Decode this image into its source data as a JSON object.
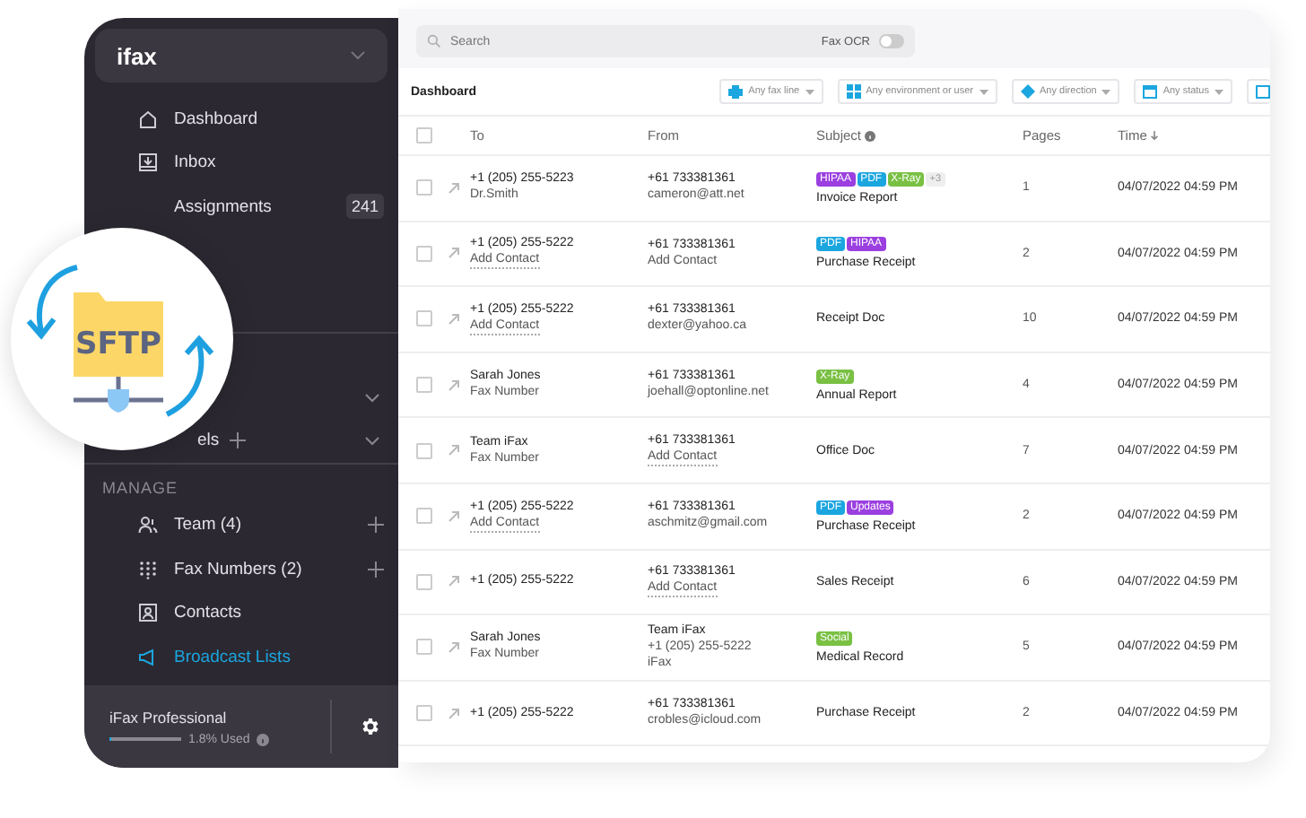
{
  "sidebar": {
    "logo": "ifax",
    "nav": [
      {
        "label": "Dashboard",
        "selected": false
      },
      {
        "label": "Inbox",
        "selected": false
      },
      {
        "label": "Assignments",
        "selected": false,
        "badge": "241"
      }
    ],
    "groups": [
      {
        "kind": "plain"
      },
      {
        "kind": "addable",
        "label": "els"
      }
    ],
    "manage_heading": "MANAGE",
    "manage": [
      {
        "label": "Team (4)",
        "add": true,
        "selected": false
      },
      {
        "label": "Fax Numbers (2)",
        "add": true,
        "selected": false
      },
      {
        "label": "Contacts",
        "add": false,
        "selected": false
      },
      {
        "label": "Broadcast Lists",
        "add": false,
        "selected": true
      }
    ],
    "plan": {
      "name": "iFax Professional",
      "usage": "1.8% Used",
      "level": 0.018
    }
  },
  "overlay": {
    "label": "SFTP"
  },
  "search": {
    "placeholder": "Search",
    "ocr_label": "Fax OCR",
    "ocr_on": false
  },
  "header": {
    "title": "Dashboard",
    "filters": [
      "Any fax line",
      "Any environment or user",
      "Any direction",
      "Any status"
    ]
  },
  "table": {
    "select_all_checked": false,
    "columns": [
      "To",
      "From",
      "Subject",
      "Pages",
      "Time"
    ],
    "rows": [
      {
        "checked": false,
        "to": [
          {
            "text": "+1 (205) 255-5223",
            "kind": "plain"
          },
          {
            "text": "Dr.Smith",
            "kind": "plain"
          }
        ],
        "from": [
          {
            "text": "+61 733381361",
            "kind": "plain"
          },
          {
            "text": "cameron@att.net",
            "kind": "plain"
          }
        ],
        "tags": [
          {
            "text": "HIPAA",
            "color": "#9b3fe0"
          },
          {
            "text": "PDF",
            "color": "#1ba6e0"
          },
          {
            "text": "X-Ray",
            "color": "#79c043"
          }
        ],
        "more": "+3",
        "subject": "Invoice Report",
        "pages": "1",
        "time": "04/07/2022 04:59 PM"
      },
      {
        "checked": false,
        "to": [
          {
            "text": "+1 (205) 255-5222",
            "kind": "plain"
          },
          {
            "text": "Add Contact",
            "kind": "link"
          }
        ],
        "from": [
          {
            "text": "+61 733381361",
            "kind": "plain"
          },
          {
            "text": "Add Contact",
            "kind": "plain"
          }
        ],
        "tags": [
          {
            "text": "PDF",
            "color": "#1ba6e0"
          },
          {
            "text": "HIPAA",
            "color": "#9b3fe0"
          }
        ],
        "subject": "Purchase Receipt",
        "pages": "2",
        "time": "04/07/2022 04:59 PM"
      },
      {
        "checked": false,
        "to": [
          {
            "text": "+1 (205) 255-5222",
            "kind": "plain"
          },
          {
            "text": "Add Contact",
            "kind": "link"
          }
        ],
        "from": [
          {
            "text": "+61 733381361",
            "kind": "plain"
          },
          {
            "text": "dexter@yahoo.ca",
            "kind": "plain"
          }
        ],
        "tags": [],
        "subject": "Receipt Doc",
        "pages": "10",
        "time": "04/07/2022 04:59 PM"
      },
      {
        "checked": false,
        "to": [
          {
            "text": "Sarah Jones",
            "kind": "plain"
          },
          {
            "text": "Fax Number",
            "kind": "plain"
          }
        ],
        "from": [
          {
            "text": "+61 733381361",
            "kind": "plain"
          },
          {
            "text": "joehall@optonline.net",
            "kind": "plain"
          }
        ],
        "tags": [
          {
            "text": "X-Ray",
            "color": "#79c043"
          }
        ],
        "subject": "Annual Report",
        "pages": "4",
        "time": "04/07/2022 04:59 PM"
      },
      {
        "checked": false,
        "to": [
          {
            "text": "Team iFax",
            "kind": "plain"
          },
          {
            "text": "Fax Number",
            "kind": "plain"
          }
        ],
        "from": [
          {
            "text": "+61 733381361",
            "kind": "plain"
          },
          {
            "text": "Add Contact",
            "kind": "link"
          }
        ],
        "tags": [],
        "subject": "Office Doc",
        "pages": "7",
        "time": "04/07/2022 04:59 PM"
      },
      {
        "checked": false,
        "to": [
          {
            "text": "+1 (205) 255-5222",
            "kind": "plain"
          },
          {
            "text": "Add Contact",
            "kind": "link"
          }
        ],
        "from": [
          {
            "text": "+61 733381361",
            "kind": "plain"
          },
          {
            "text": "aschmitz@gmail.com",
            "kind": "plain"
          }
        ],
        "tags": [
          {
            "text": "PDF",
            "color": "#1ba6e0"
          },
          {
            "text": "Updates",
            "color": "#9b3fe0"
          }
        ],
        "subject": "Purchase Receipt",
        "pages": "2",
        "time": "04/07/2022 04:59 PM"
      },
      {
        "checked": false,
        "to": [
          {
            "text": "+1 (205) 255-5222",
            "kind": "plain"
          }
        ],
        "from": [
          {
            "text": "+61 733381361",
            "kind": "plain"
          },
          {
            "text": "Add Contact",
            "kind": "link"
          }
        ],
        "tags": [],
        "subject": "Sales Receipt",
        "pages": "6",
        "time": "04/07/2022 04:59 PM"
      },
      {
        "checked": false,
        "to": [
          {
            "text": "Sarah Jones",
            "kind": "plain"
          },
          {
            "text": "Fax Number",
            "kind": "plain"
          }
        ],
        "from": [
          {
            "text": "Team iFax",
            "kind": "plain"
          },
          {
            "text": "+1 (205) 255-5222",
            "kind": "plain"
          },
          {
            "text": "iFax",
            "kind": "plain"
          }
        ],
        "tags": [
          {
            "text": "Social",
            "color": "#79c043"
          }
        ],
        "subject": "Medical Record",
        "pages": "5",
        "time": "04/07/2022 04:59 PM"
      },
      {
        "checked": false,
        "to": [
          {
            "text": "+1 (205) 255-5222",
            "kind": "plain"
          }
        ],
        "from": [
          {
            "text": "+61 733381361",
            "kind": "plain"
          },
          {
            "text": "crobles@icloud.com",
            "kind": "plain"
          }
        ],
        "tags": [],
        "subject": "Purchase Receipt",
        "pages": "2",
        "time": "04/07/2022 04:59 PM"
      }
    ]
  }
}
